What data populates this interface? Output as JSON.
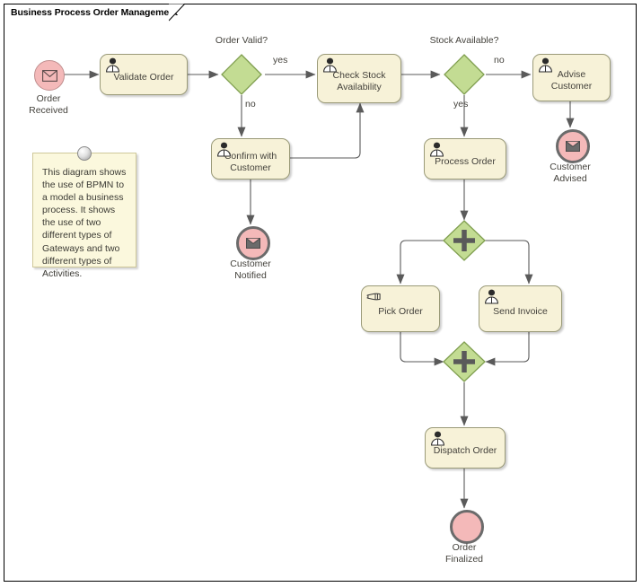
{
  "frame": {
    "title": "Business Process Order Management"
  },
  "colors": {
    "task_fill": "#f7f2d8",
    "task_stroke": "#9a9a78",
    "gateway_fill": "#c3dc93",
    "gateway_stroke": "#7f9e4f",
    "event_fill": "#f4b9b9",
    "start_stroke": "#c08f8f",
    "end_stroke": "#6b6b6b",
    "note_fill": "#fbf8dd",
    "note_stroke": "#cfc99a",
    "flow_stroke": "#5a5a5a",
    "text": "#44423c"
  },
  "note": {
    "text": "This diagram shows the use of BPMN to a model a business process. It shows the use of two different types of Gateways and two different types of Activities."
  },
  "events": [
    {
      "id": "order-received",
      "name": "Order Received",
      "label": "Order\nReceived",
      "type": "start",
      "icon": "envelope-icon",
      "icon_style": "outline"
    },
    {
      "id": "customer-notified",
      "name": "Customer Notified",
      "label": "Customer\nNotified",
      "type": "end",
      "icon": "envelope-icon",
      "icon_style": "filled"
    },
    {
      "id": "customer-advised",
      "name": "Customer Advised",
      "label": "Customer\nAdvised",
      "type": "end",
      "icon": "envelope-icon",
      "icon_style": "filled"
    },
    {
      "id": "order-finalized",
      "name": "Order Finalized",
      "label": "Order\nFinalized",
      "type": "end",
      "icon": "none",
      "icon_style": "none"
    }
  ],
  "tasks": [
    {
      "id": "validate-order",
      "label": "Validate Order",
      "icon": "user-task-icon"
    },
    {
      "id": "check-stock",
      "label": "Check Stock\nAvailability",
      "icon": "user-task-icon"
    },
    {
      "id": "advise-customer",
      "label": "Advise\nCustomer",
      "icon": "user-task-icon"
    },
    {
      "id": "confirm-with-customer",
      "label": "Confirm with\nCustomer",
      "icon": "user-task-icon"
    },
    {
      "id": "process-order",
      "label": "Process Order",
      "icon": "user-task-icon"
    },
    {
      "id": "pick-order",
      "label": "Pick Order",
      "icon": "manual-task-icon"
    },
    {
      "id": "send-invoice",
      "label": "Send Invoice",
      "icon": "user-task-icon"
    },
    {
      "id": "dispatch-order",
      "label": "Dispatch Order",
      "icon": "user-task-icon"
    }
  ],
  "gateways": [
    {
      "id": "order-valid",
      "kind": "exclusive",
      "label": "Order Valid?"
    },
    {
      "id": "stock-available",
      "kind": "exclusive",
      "label": "Stock Available?"
    },
    {
      "id": "parallel-split",
      "kind": "parallel",
      "label": ""
    },
    {
      "id": "parallel-join",
      "kind": "parallel",
      "label": ""
    }
  ],
  "flow_labels": {
    "order_valid_yes": "yes",
    "order_valid_no": "no",
    "stock_available_no": "no",
    "stock_available_yes": "yes"
  }
}
